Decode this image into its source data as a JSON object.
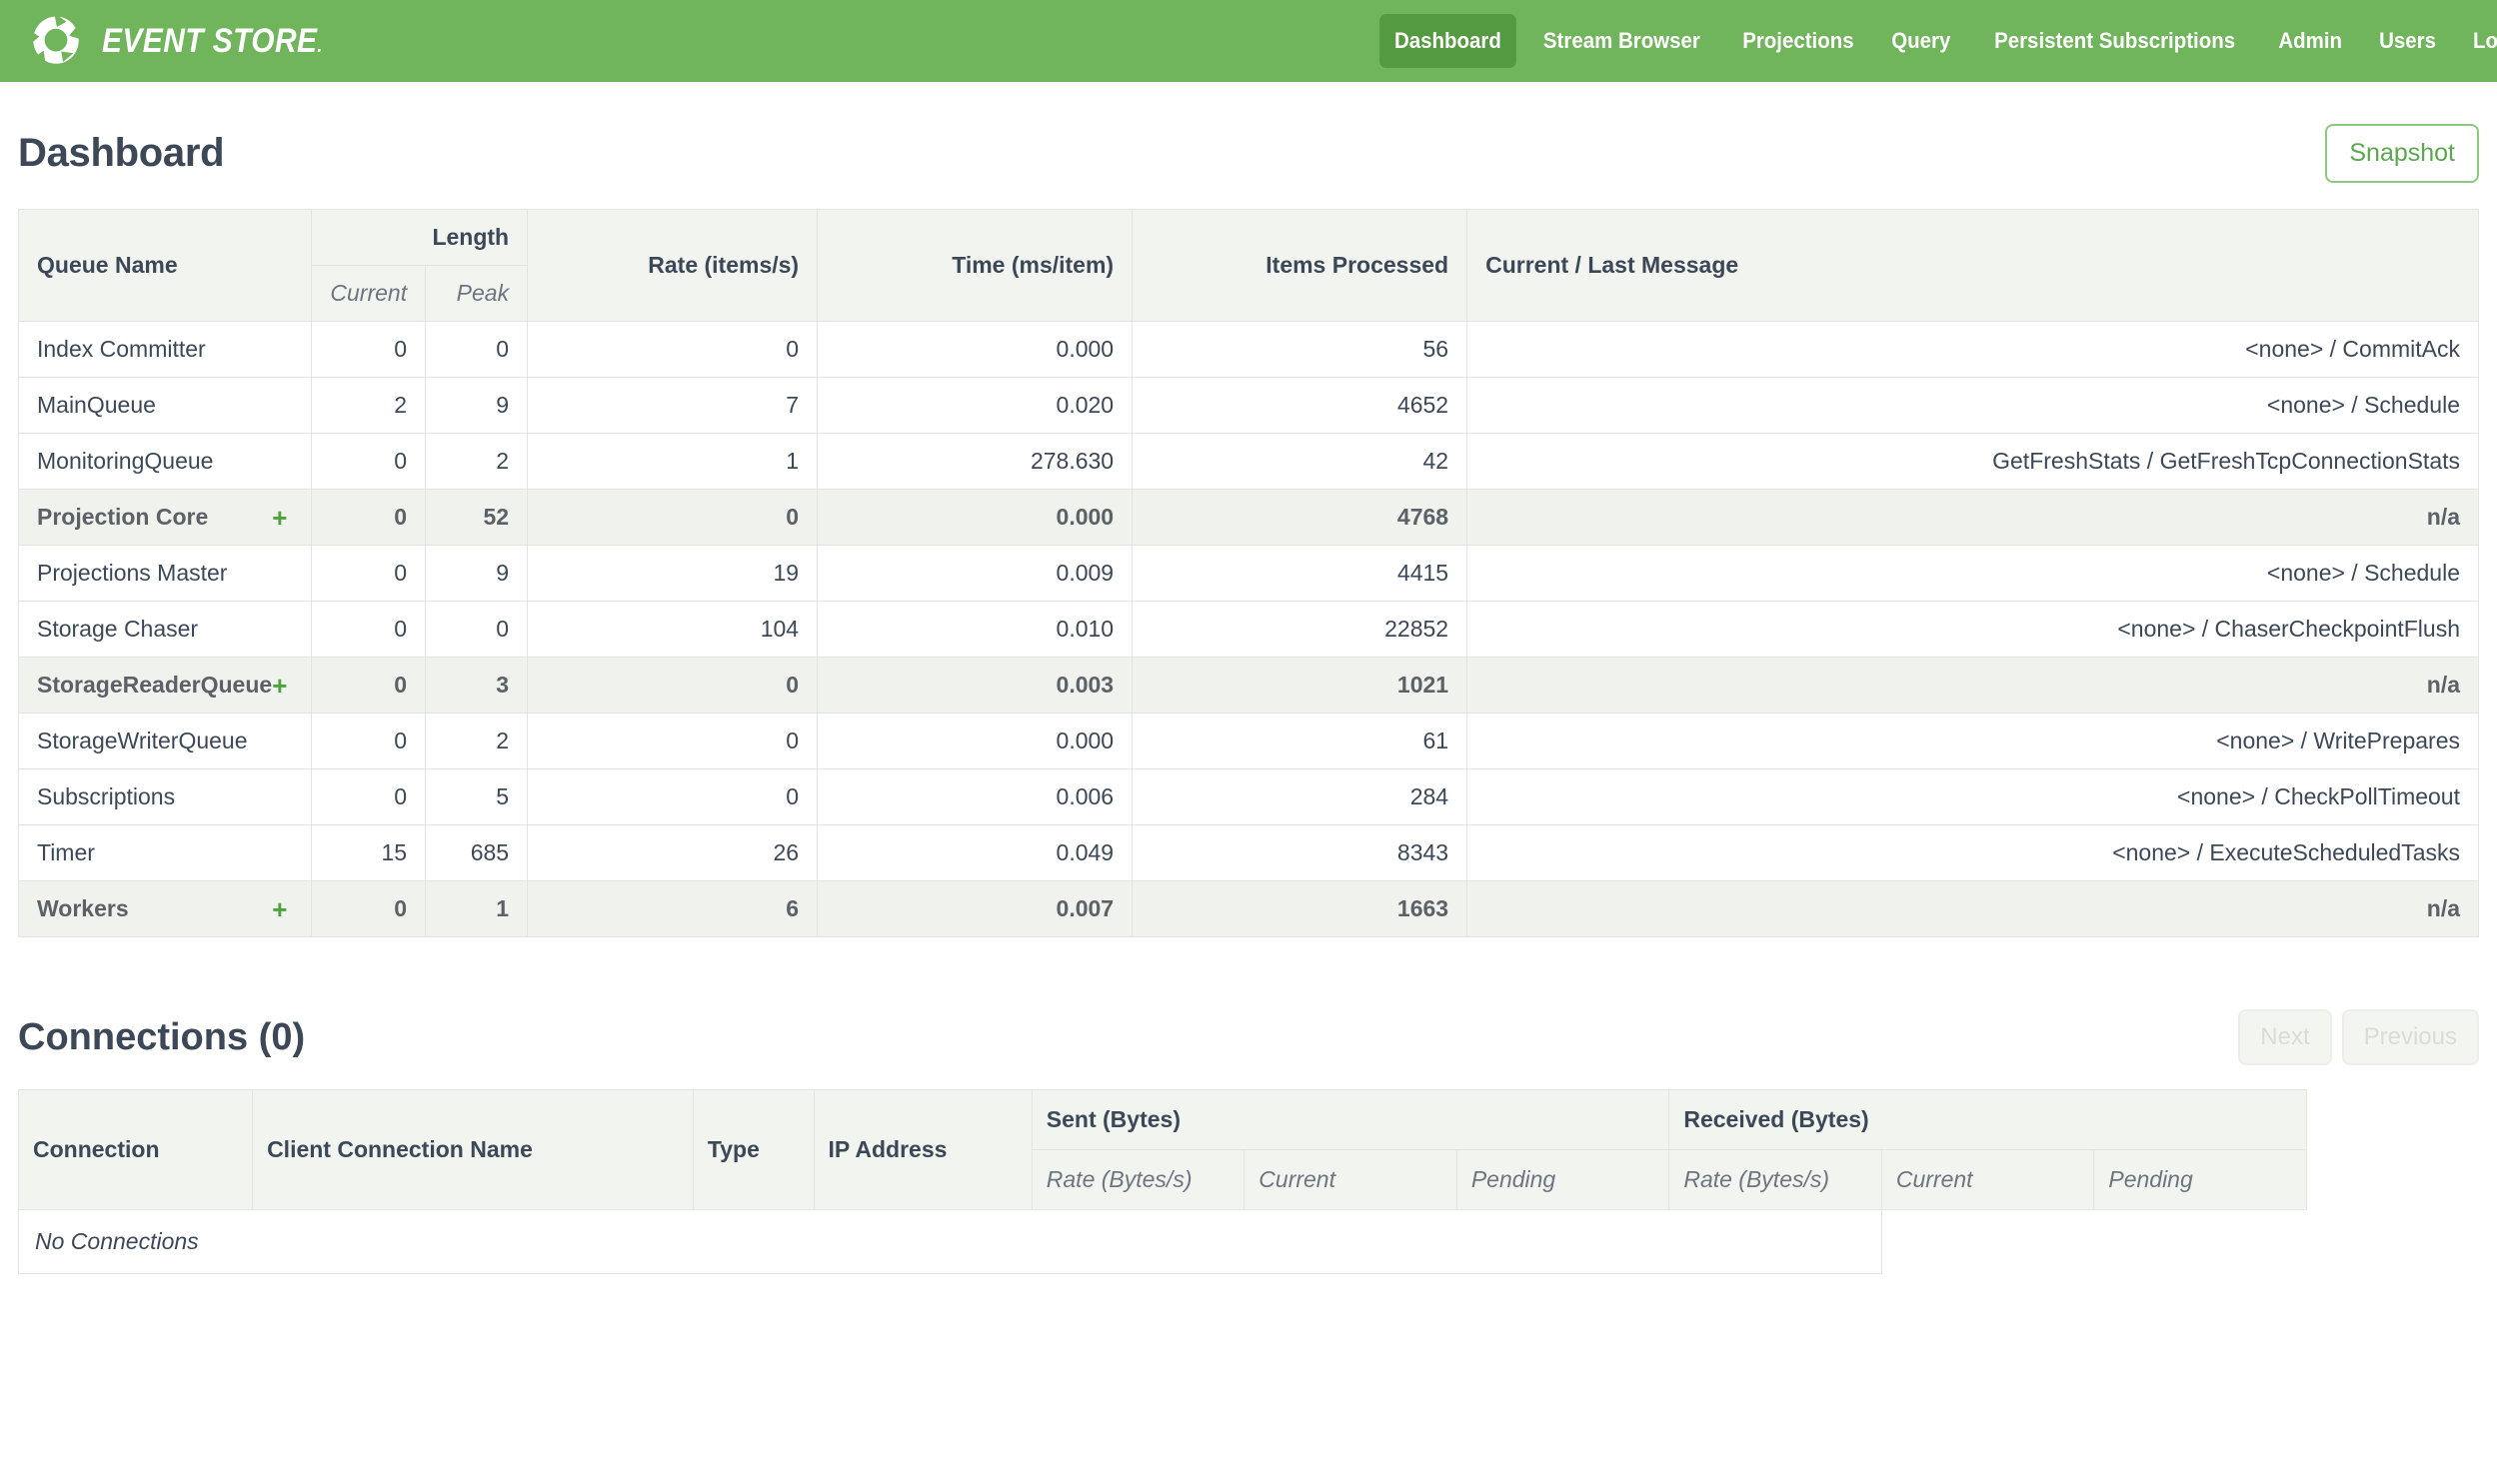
{
  "navbar": {
    "brand": "EVENT STORE",
    "brand_dot": ".",
    "logo_icon": "event-store-logo-icon",
    "links": [
      {
        "label": "Dashboard",
        "active": true
      },
      {
        "label": "Stream Browser",
        "active": false
      },
      {
        "label": "Projections",
        "active": false
      },
      {
        "label": "Query",
        "active": false
      },
      {
        "label": "Persistent Subscriptions",
        "active": false
      },
      {
        "label": "Admin",
        "active": false
      },
      {
        "label": "Users",
        "active": false
      },
      {
        "label": "Log Out",
        "active": false
      }
    ]
  },
  "header": {
    "title": "Dashboard",
    "snapshot_label": "Snapshot"
  },
  "queues": {
    "columns": {
      "name": "Queue Name",
      "length": "Length",
      "length_current": "Current",
      "length_peak": "Peak",
      "rate": "Rate (items/s)",
      "time": "Time (ms/item)",
      "items_processed": "Items Processed",
      "message": "Current / Last Message"
    },
    "expand_glyph": "+",
    "rows": [
      {
        "name": "Index Committer",
        "expandable": false,
        "current": "0",
        "peak": "0",
        "rate": "0",
        "time": "0.000",
        "items": "56",
        "message": "<none> / CommitAck",
        "highlight": false
      },
      {
        "name": "MainQueue",
        "expandable": false,
        "current": "2",
        "peak": "9",
        "rate": "7",
        "time": "0.020",
        "items": "4652",
        "message": "<none> / Schedule",
        "highlight": false
      },
      {
        "name": "MonitoringQueue",
        "expandable": false,
        "current": "0",
        "peak": "2",
        "rate": "1",
        "time": "278.630",
        "items": "42",
        "message": "GetFreshStats / GetFreshTcpConnectionStats",
        "highlight": false
      },
      {
        "name": "Projection Core",
        "expandable": true,
        "current": "0",
        "peak": "52",
        "rate": "0",
        "time": "0.000",
        "items": "4768",
        "message": "n/a",
        "highlight": true
      },
      {
        "name": "Projections Master",
        "expandable": false,
        "current": "0",
        "peak": "9",
        "rate": "19",
        "time": "0.009",
        "items": "4415",
        "message": "<none> / Schedule",
        "highlight": false
      },
      {
        "name": "Storage Chaser",
        "expandable": false,
        "current": "0",
        "peak": "0",
        "rate": "104",
        "time": "0.010",
        "items": "22852",
        "message": "<none> / ChaserCheckpointFlush",
        "highlight": false
      },
      {
        "name": "StorageReaderQueue",
        "expandable": true,
        "current": "0",
        "peak": "3",
        "rate": "0",
        "time": "0.003",
        "items": "1021",
        "message": "n/a",
        "highlight": true
      },
      {
        "name": "StorageWriterQueue",
        "expandable": false,
        "current": "0",
        "peak": "2",
        "rate": "0",
        "time": "0.000",
        "items": "61",
        "message": "<none> / WritePrepares",
        "highlight": false
      },
      {
        "name": "Subscriptions",
        "expandable": false,
        "current": "0",
        "peak": "5",
        "rate": "0",
        "time": "0.006",
        "items": "284",
        "message": "<none> / CheckPollTimeout",
        "highlight": false
      },
      {
        "name": "Timer",
        "expandable": false,
        "current": "15",
        "peak": "685",
        "rate": "26",
        "time": "0.049",
        "items": "8343",
        "message": "<none> / ExecuteScheduledTasks",
        "highlight": false
      },
      {
        "name": "Workers",
        "expandable": true,
        "current": "0",
        "peak": "1",
        "rate": "6",
        "time": "0.007",
        "items": "1663",
        "message": "n/a",
        "highlight": true
      }
    ]
  },
  "connections": {
    "title": "Connections (0)",
    "next_label": "Next",
    "previous_label": "Previous",
    "columns": {
      "connection": "Connection",
      "client_connection_name": "Client Connection Name",
      "type": "Type",
      "ip_address": "IP Address",
      "sent": "Sent (Bytes)",
      "received": "Received (Bytes)",
      "sent_rate": "Rate (Bytes/s)",
      "sent_current": "Current",
      "sent_pending": "Pending",
      "received_rate": "Rate (Bytes/s)",
      "received_current": "Current",
      "received_pending": "Pending"
    },
    "empty_message": "No Connections",
    "rows": []
  },
  "colors": {
    "brand_green": "#70b45c",
    "active_nav_green": "#539a40",
    "snapshot_green": "#5aa84f",
    "row_highlight": "#f0f2ee",
    "header_bg": "#f2f4ef",
    "text": "#3c4858",
    "plus_green": "#4ca43c"
  }
}
